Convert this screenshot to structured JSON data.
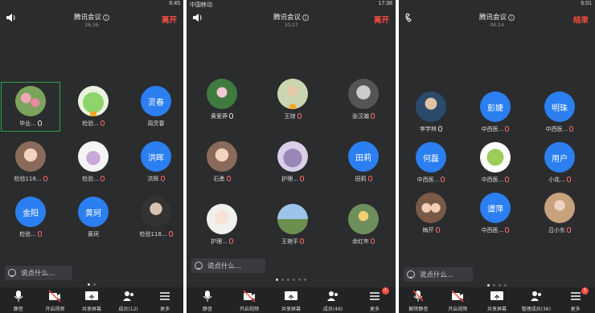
{
  "p1": {
    "status_time": "6:45",
    "title": "腾讯会议",
    "time": "26:36",
    "leave": "离开",
    "tiles": [
      {
        "name": "毕业...",
        "avatar": "img-flowers",
        "mic": "on",
        "active": true
      },
      {
        "name": "检验...",
        "avatar": "img-frog",
        "mic": "off",
        "crown": true
      },
      {
        "name": "周灵春",
        "avatar_text": "灵春",
        "mic": "none"
      },
      {
        "name": "检验118...",
        "avatar": "img-girl",
        "mic": "off"
      },
      {
        "name": "检验...",
        "avatar": "img-cat",
        "mic": "off"
      },
      {
        "name": "洪晖",
        "avatar_text": "洪晖",
        "mic": "off"
      },
      {
        "name": "检验...",
        "avatar_text": "金阳",
        "mic": "off"
      },
      {
        "name": "黄珂",
        "avatar_text": "黄珂",
        "mic": "none"
      },
      {
        "name": "检验118...",
        "avatar": "img-man",
        "mic": "off"
      }
    ],
    "chat": "说点什么...",
    "toolbar": [
      {
        "label": "静音",
        "icon": "mic-icon"
      },
      {
        "label": "开启视频",
        "icon": "camera-off-icon"
      },
      {
        "label": "共享屏幕",
        "icon": "share-screen-icon"
      },
      {
        "label": "成员(12)",
        "icon": "members-icon"
      },
      {
        "label": "更多",
        "icon": "more-icon"
      }
    ]
  },
  "p2": {
    "status_carrier": "中国移动",
    "status_time": "17:38",
    "title": "腾讯会议",
    "time": "10:27",
    "leave": "离开",
    "tiles": [
      {
        "name": "黄爱莽",
        "avatar": "img-lotus",
        "mic": "on"
      },
      {
        "name": "王琼",
        "avatar": "img-person",
        "mic": "off",
        "crown": true
      },
      {
        "name": "张汉瀚",
        "avatar": "img-dog",
        "mic": "off"
      },
      {
        "name": "石勇",
        "avatar": "img-girl",
        "mic": "off"
      },
      {
        "name": "护理...",
        "avatar": "img-bear",
        "mic": "off"
      },
      {
        "name": "田莉",
        "avatar_text": "田莉",
        "mic": "off"
      },
      {
        "name": "护理...",
        "avatar": "img-anime",
        "mic": "off"
      },
      {
        "name": "王艳平",
        "avatar": "img-scene",
        "mic": "off"
      },
      {
        "name": "余红年",
        "avatar": "img-flower2",
        "mic": "off"
      }
    ],
    "chat": "说点什么...",
    "toolbar": [
      {
        "label": "静音",
        "icon": "mic-icon"
      },
      {
        "label": "开启视频",
        "icon": "camera-off-icon"
      },
      {
        "label": "共享屏幕",
        "icon": "share-screen-icon"
      },
      {
        "label": "成员(49)",
        "icon": "members-icon"
      },
      {
        "label": "更多",
        "icon": "more-icon",
        "badge": "1"
      }
    ]
  },
  "p3": {
    "status_time": "6:01",
    "title": "腾讯会议",
    "time": "04:24",
    "leave": "结束",
    "tiles": [
      {
        "name": "李学林",
        "avatar": "img-man2",
        "mic": "on"
      },
      {
        "name": "中西医...",
        "avatar_text": "彭婕",
        "mic": "off"
      },
      {
        "name": "中西医...",
        "avatar_text": "明珠",
        "mic": "off"
      },
      {
        "name": "中西医...",
        "avatar_text": "何磊",
        "mic": "off"
      },
      {
        "name": "中西医...",
        "avatar": "img-grapes",
        "mic": "off"
      },
      {
        "name": "小花...",
        "avatar_text": "用户",
        "mic": "off"
      },
      {
        "name": "梅芹",
        "avatar": "img-kids",
        "mic": "off"
      },
      {
        "name": "中西医...",
        "avatar_text": "谭萍",
        "mic": "off"
      },
      {
        "name": "吕小东",
        "avatar": "img-lady",
        "mic": "off"
      }
    ],
    "chat": "说点什么...",
    "toolbar": [
      {
        "label": "解除静音",
        "icon": "mic-muted-icon"
      },
      {
        "label": "开启视频",
        "icon": "camera-off-icon"
      },
      {
        "label": "共享屏幕",
        "icon": "share-screen-icon"
      },
      {
        "label": "管理成员(36)",
        "icon": "members-icon"
      },
      {
        "label": "更多",
        "icon": "more-icon",
        "badge": "1"
      }
    ]
  }
}
